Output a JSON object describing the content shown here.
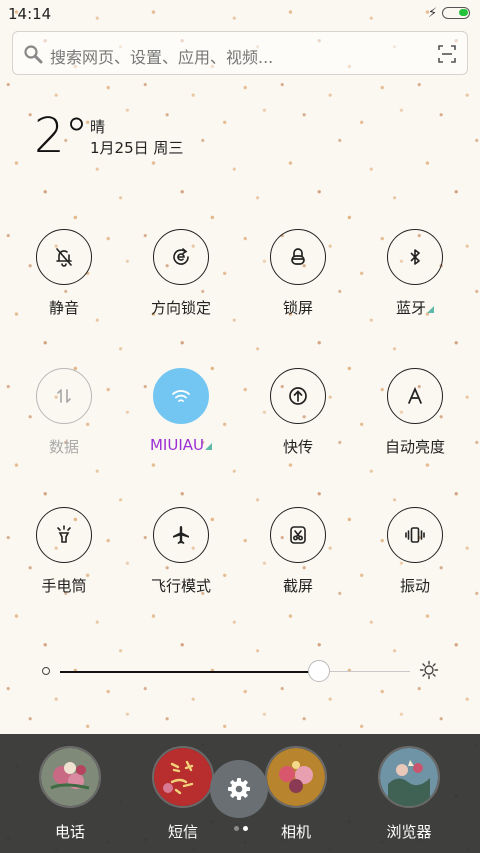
{
  "status_bar": {
    "time": "14:14"
  },
  "search": {
    "placeholder": "搜索网页、设置、应用、视频..."
  },
  "weather": {
    "temperature": "2°",
    "condition": "晴",
    "date": "1月25日 周三"
  },
  "toggles": [
    {
      "label": "静音",
      "icon": "bell-off-icon",
      "state": "off"
    },
    {
      "label": "方向锁定",
      "icon": "rotation-lock-icon",
      "state": "off"
    },
    {
      "label": "锁屏",
      "icon": "lock-icon",
      "state": "off"
    },
    {
      "label": "蓝牙",
      "icon": "bluetooth-icon",
      "state": "off"
    },
    {
      "label": "数据",
      "icon": "data-arrows-icon",
      "state": "disabled"
    },
    {
      "label": "MIUIAU",
      "icon": "wifi-icon",
      "state": "on"
    },
    {
      "label": "快传",
      "icon": "transfer-icon",
      "state": "off"
    },
    {
      "label": "自动亮度",
      "icon": "auto-brightness-icon",
      "state": "off"
    },
    {
      "label": "手电筒",
      "icon": "flashlight-icon",
      "state": "off"
    },
    {
      "label": "飞行模式",
      "icon": "airplane-icon",
      "state": "off"
    },
    {
      "label": "截屏",
      "icon": "screenshot-icon",
      "state": "off"
    },
    {
      "label": "振动",
      "icon": "vibrate-icon",
      "state": "off"
    }
  ],
  "brightness": {
    "level": 0.74
  },
  "dock": {
    "items": [
      {
        "label": "电话",
        "icon": "phone-app-icon"
      },
      {
        "label": "短信",
        "icon": "messages-app-icon"
      },
      {
        "label": "相机",
        "icon": "camera-app-icon"
      },
      {
        "label": "浏览器",
        "icon": "browser-app-icon"
      }
    ],
    "settings_icon": "gear-icon",
    "active_page": 1
  },
  "colors": {
    "accent": "#74c6f2",
    "wifi_label": "#9c2fd4",
    "corner_mark": "#5fb9a9",
    "battery": "#25c23c",
    "dock_bg": "#303030"
  }
}
